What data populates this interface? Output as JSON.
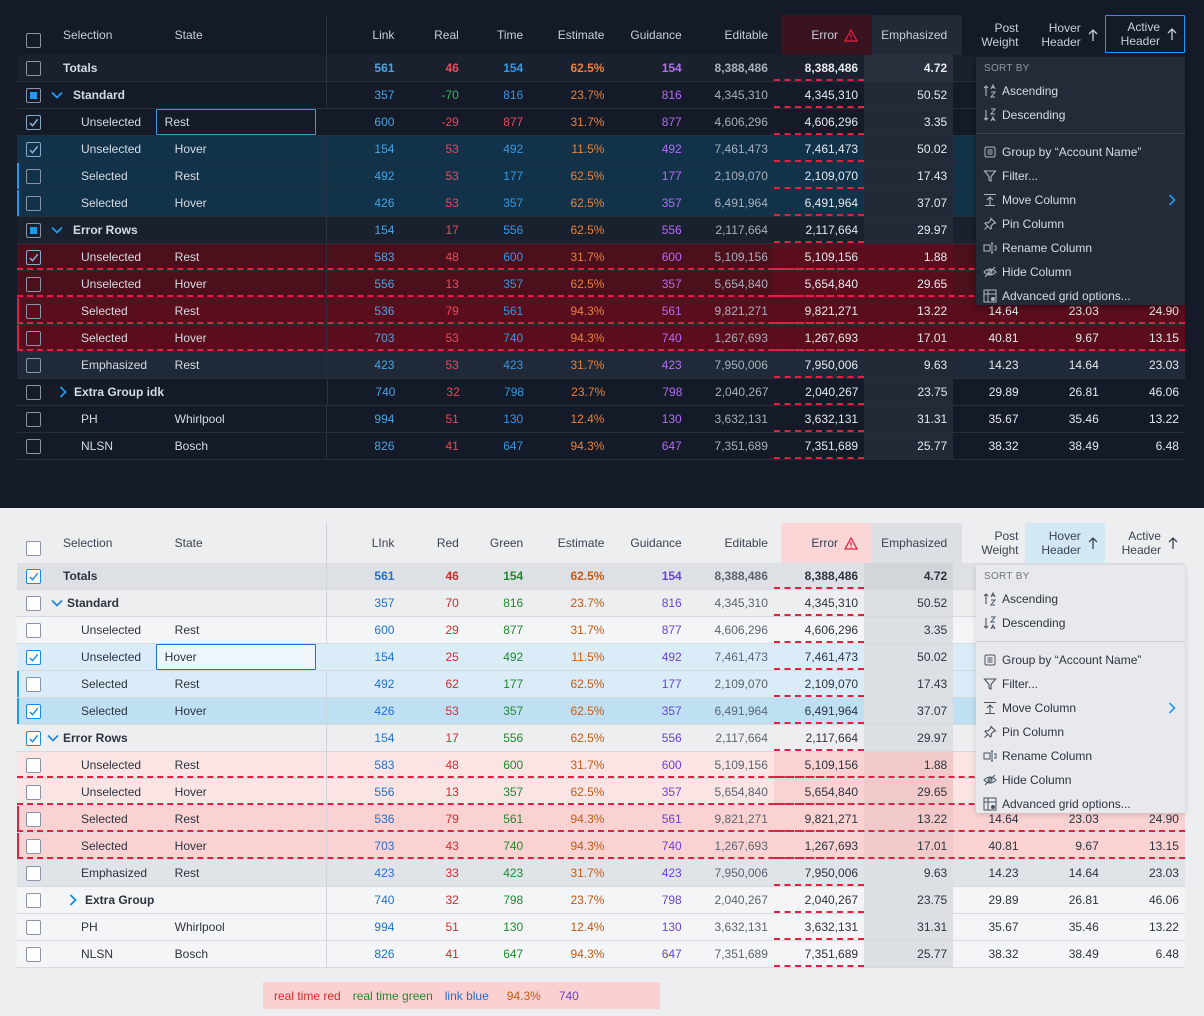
{
  "colors": {
    "dark": {
      "link": "#4ba3e3",
      "red": "#e94b5b",
      "green": "#3fb560",
      "blue": "#3399e6",
      "estimate": "#e8823c",
      "guidance": "#b36bf5",
      "muted": "#a8b0bd"
    },
    "light": {
      "link": "#1f6fd0",
      "red": "#d42b2b",
      "green": "#1f8a2e",
      "blue": "#1f6fd0",
      "estimate": "#c45a14",
      "guidance": "#6a42d6",
      "muted": "#5a6470"
    }
  },
  "dark": {
    "headers": {
      "selection": "Selection",
      "state": "State",
      "link": "Link",
      "real": "Real",
      "time": "Time",
      "estimate": "Estimate",
      "guidance": "Guidance",
      "editable": "Editable",
      "error": "Error",
      "emphasized": "Emphasized",
      "post_weight_1": "Post",
      "post_weight_2": "Weight",
      "hover_1": "Hover",
      "hover_2": "Header",
      "active_1": "Active",
      "active_2": "Header"
    },
    "rows": [
      {
        "type": "totals",
        "sel": "Totals",
        "state": "",
        "cb": "off",
        "link": "561",
        "real": "46",
        "time": "154",
        "est": "62.5%",
        "guid": "154",
        "edit": "8,388,486",
        "err": "8,388,486",
        "emph": "4.72",
        "pw": "",
        "hh": "",
        "ah": "",
        "bg": "#1a212e"
      },
      {
        "type": "group",
        "sel": "Standard",
        "state": "",
        "cb": "ind",
        "chev": "down",
        "link": "357",
        "real": "-70",
        "time": "816",
        "est": "23.7%",
        "guid": "816",
        "edit": "4,345,310",
        "err": "4,345,310",
        "emph": "50.52",
        "pw": "",
        "hh": "",
        "ah": "",
        "realColor": "green",
        "bg": "#141a27"
      },
      {
        "type": "child",
        "sel": "Unselected",
        "state": "Rest",
        "cb": "on",
        "link": "600",
        "real": "-29",
        "time": "877",
        "est": "31.7%",
        "guid": "877",
        "edit": "4,606,296",
        "err": "4,606,296",
        "emph": "3.35",
        "pw": "",
        "hh": "",
        "ah": "",
        "timeColor": "red",
        "bg": "#141a27",
        "stateBox": true
      },
      {
        "type": "child",
        "sel": "Unselected",
        "state": "Hover",
        "cb": "on",
        "link": "154",
        "real": "53",
        "time": "492",
        "est": "11.5%",
        "guid": "492",
        "edit": "7,461,473",
        "err": "7,461,473",
        "emph": "50.02",
        "pw": "",
        "hh": "",
        "ah": "",
        "bg": "#113249"
      },
      {
        "type": "child",
        "sel": "Selected",
        "state": "Rest",
        "cb": "off",
        "link": "492",
        "real": "53",
        "time": "177",
        "est": "62.5%",
        "guid": "177",
        "edit": "2,109,070",
        "err": "2,109,070",
        "emph": "17.43",
        "pw": "",
        "hh": "",
        "ah": "",
        "bg": "#113249",
        "leftBar": true
      },
      {
        "type": "child",
        "sel": "Selected",
        "state": "Hover",
        "cb": "off",
        "link": "426",
        "real": "53",
        "time": "357",
        "est": "62.5%",
        "guid": "357",
        "edit": "6,491,964",
        "err": "6,491,964",
        "emph": "37.07",
        "pw": "",
        "hh": "",
        "ah": "",
        "bg": "#113249",
        "leftBar": true
      },
      {
        "type": "group",
        "sel": "Error Rows",
        "state": "",
        "cb": "ind",
        "chev": "down",
        "link": "154",
        "real": "17",
        "time": "556",
        "est": "62.5%",
        "guid": "556",
        "edit": "2,117,664",
        "err": "2,117,664",
        "emph": "29.97",
        "pw": "",
        "hh": "",
        "ah": "",
        "bg": "#1a212e"
      },
      {
        "type": "child",
        "sel": "Unselected",
        "state": "Rest",
        "cb": "on",
        "link": "583",
        "real": "48",
        "time": "600",
        "est": "31.7%",
        "guid": "600",
        "edit": "5,109,156",
        "err": "5,109,156",
        "emph": "1.88",
        "pw": "",
        "hh": "",
        "ah": "",
        "bg": "#4c0f1c",
        "dash": true
      },
      {
        "type": "child",
        "sel": "Unselected",
        "state": "Hover",
        "cb": "off",
        "link": "556",
        "real": "13",
        "time": "357",
        "est": "62.5%",
        "guid": "357",
        "edit": "5,654,840",
        "err": "5,654,840",
        "emph": "29.65",
        "pw": "",
        "hh": "",
        "ah": "",
        "bg": "#4c0f1c",
        "dash": true
      },
      {
        "type": "child",
        "sel": "Selected",
        "state": "Rest",
        "cb": "off",
        "link": "536",
        "real": "79",
        "time": "561",
        "est": "94.3%",
        "guid": "561",
        "edit": "9,821,271",
        "err": "9,821,271",
        "emph": "13.22",
        "pw": "14.64",
        "hh": "23.03",
        "ah": "24.90",
        "bg": "#5a0d1c",
        "leftBar": true,
        "dash": true
      },
      {
        "type": "child",
        "sel": "Selected",
        "state": "Hover",
        "cb": "off",
        "link": "703",
        "real": "53",
        "time": "740",
        "est": "94.3%",
        "guid": "740",
        "edit": "1,267,693",
        "err": "1,267,693",
        "emph": "17.01",
        "pw": "40.81",
        "hh": "9.67",
        "ah": "13.15",
        "bg": "#5a0d1c",
        "leftBar": true,
        "dash": true
      },
      {
        "type": "child",
        "sel": "Emphasized",
        "state": "Rest",
        "cb": "off",
        "link": "423",
        "real": "53",
        "time": "423",
        "est": "31.7%",
        "guid": "423",
        "edit": "7,950,006",
        "err": "7,950,006",
        "emph": "9.63",
        "pw": "14.23",
        "hh": "14.64",
        "ah": "23.03",
        "bg": "#1f2937"
      },
      {
        "type": "group",
        "sel": "Extra Group idk",
        "state": "",
        "cb": "off",
        "chev": "right",
        "link": "740",
        "real": "32",
        "time": "798",
        "est": "23.7%",
        "guid": "798",
        "edit": "2,040,267",
        "err": "2,040,267",
        "emph": "23.75",
        "pw": "29.89",
        "hh": "26.81",
        "ah": "46.06",
        "bg": "#141a27"
      },
      {
        "type": "plain",
        "sel": "PH",
        "state": "Whirlpool",
        "cb": "off",
        "link": "994",
        "real": "51",
        "time": "130",
        "est": "12.4%",
        "guid": "130",
        "edit": "3,632,131",
        "err": "3,632,131",
        "emph": "31.31",
        "pw": "35.67",
        "hh": "35.46",
        "ah": "13.22",
        "bg": "#141a27"
      },
      {
        "type": "plain",
        "sel": "NLSN",
        "state": "Bosch",
        "cb": "off",
        "link": "826",
        "real": "41",
        "time": "647",
        "est": "94.3%",
        "guid": "647",
        "edit": "7,351,689",
        "err": "7,351,689",
        "emph": "25.77",
        "pw": "38.32",
        "hh": "38.49",
        "ah": "6.48",
        "bg": "#141a27"
      }
    ]
  },
  "light": {
    "headers": {
      "selection": "Selection",
      "state": "State",
      "link": "LInk",
      "real": "Red",
      "time": "Green",
      "estimate": "Estimate",
      "guidance": "Guidance",
      "editable": "Editable",
      "error": "Error",
      "emphasized": "Emphasized",
      "post_weight_1": "Post",
      "post_weight_2": "Weight",
      "hover_1": "Hover",
      "hover_2": "Header",
      "active_1": "Active",
      "active_2": "Header"
    },
    "rows": [
      {
        "type": "totals",
        "sel": "Totals",
        "state": "",
        "cb": "on",
        "link": "561",
        "real": "46",
        "time": "154",
        "est": "62.5%",
        "guid": "154",
        "edit": "8,388,486",
        "err": "8,388,486",
        "emph": "4.72",
        "pw": "",
        "hh": "",
        "ah": "",
        "timeColor": "green",
        "bg": "#dde0e4"
      },
      {
        "type": "group",
        "sel": "Standard",
        "state": "",
        "cb": "off",
        "chev": "down",
        "link": "357",
        "real": "70",
        "time": "816",
        "est": "23.7%",
        "guid": "816",
        "edit": "4,345,310",
        "err": "4,345,310",
        "emph": "50.52",
        "pw": "",
        "hh": "",
        "ah": "",
        "timeColor": "green",
        "bg": "#eceef0"
      },
      {
        "type": "child",
        "sel": "Unselected",
        "state": "Rest",
        "cb": "off",
        "link": "600",
        "real": "29",
        "time": "877",
        "est": "31.7%",
        "guid": "877",
        "edit": "4,606,296",
        "err": "4,606,296",
        "emph": "3.35",
        "pw": "",
        "hh": "",
        "ah": "",
        "timeColor": "green",
        "bg": "#f4f5f6"
      },
      {
        "type": "child",
        "sel": "Unselected",
        "state": "Hover",
        "cb": "on",
        "link": "154",
        "real": "25",
        "time": "492",
        "est": "11.5%",
        "guid": "492",
        "edit": "7,461,473",
        "err": "7,461,473",
        "emph": "50.02",
        "pw": "",
        "hh": "",
        "ah": "",
        "timeColor": "green",
        "bg": "#d9ecf7",
        "stateBox": true
      },
      {
        "type": "child",
        "sel": "Selected",
        "state": "Rest",
        "cb": "off",
        "link": "492",
        "real": "62",
        "time": "177",
        "est": "62.5%",
        "guid": "177",
        "edit": "2,109,070",
        "err": "2,109,070",
        "emph": "17.43",
        "pw": "",
        "hh": "",
        "ah": "",
        "timeColor": "green",
        "bg": "#d9ecf7",
        "leftBar": true
      },
      {
        "type": "child",
        "sel": "Selected",
        "state": "Hover",
        "cb": "on",
        "link": "426",
        "real": "53",
        "time": "357",
        "est": "62.5%",
        "guid": "357",
        "edit": "6,491,964",
        "err": "6,491,964",
        "emph": "37.07",
        "pw": "",
        "hh": "",
        "ah": "",
        "timeColor": "green",
        "bg": "#bfe0f2",
        "leftBar": true
      },
      {
        "type": "group",
        "sel": "Error Rows",
        "state": "",
        "cb": "on",
        "chev": "down",
        "link": "154",
        "real": "17",
        "time": "556",
        "est": "62.5%",
        "guid": "556",
        "edit": "2,117,664",
        "err": "2,117,664",
        "emph": "29.97",
        "pw": "",
        "hh": "",
        "ah": "",
        "timeColor": "green",
        "bg": "#eceef0"
      },
      {
        "type": "child",
        "sel": "Unselected",
        "state": "Rest",
        "cb": "off",
        "link": "583",
        "real": "48",
        "time": "600",
        "est": "31.7%",
        "guid": "600",
        "edit": "5,109,156",
        "err": "5,109,156",
        "emph": "1.88",
        "pw": "",
        "hh": "",
        "ah": "",
        "timeColor": "green",
        "bg": "#fbe4e4",
        "dash": true
      },
      {
        "type": "child",
        "sel": "Unselected",
        "state": "Hover",
        "cb": "off",
        "link": "556",
        "real": "13",
        "time": "357",
        "est": "62.5%",
        "guid": "357",
        "edit": "5,654,840",
        "err": "5,654,840",
        "emph": "29.65",
        "pw": "",
        "hh": "",
        "ah": "",
        "timeColor": "green",
        "bg": "#fbe4e4",
        "dash": true
      },
      {
        "type": "child",
        "sel": "Selected",
        "state": "Rest",
        "cb": "off",
        "link": "536",
        "real": "79",
        "time": "561",
        "est": "94.3%",
        "guid": "561",
        "edit": "9,821,271",
        "err": "9,821,271",
        "emph": "13.22",
        "pw": "14.64",
        "hh": "23.03",
        "ah": "24.90",
        "timeColor": "green",
        "bg": "#fad2d2",
        "leftBar": true,
        "dash": true
      },
      {
        "type": "child",
        "sel": "Selected",
        "state": "Hover",
        "cb": "off",
        "link": "703",
        "real": "43",
        "time": "740",
        "est": "94.3%",
        "guid": "740",
        "edit": "1,267,693",
        "err": "1,267,693",
        "emph": "17.01",
        "pw": "40.81",
        "hh": "9.67",
        "ah": "13.15",
        "timeColor": "green",
        "bg": "#fad2d2",
        "leftBar": true,
        "dash": true
      },
      {
        "type": "child",
        "sel": "Emphasized",
        "state": "Rest",
        "cb": "off",
        "link": "423",
        "real": "33",
        "time": "423",
        "est": "31.7%",
        "guid": "423",
        "edit": "7,950,006",
        "err": "7,950,006",
        "emph": "9.63",
        "pw": "14.23",
        "hh": "14.64",
        "ah": "23.03",
        "timeColor": "green",
        "bg": "#e0e3e7"
      },
      {
        "type": "group",
        "sel": "Extra Group",
        "state": "",
        "cb": "off",
        "chev": "right",
        "link": "740",
        "real": "32",
        "time": "798",
        "est": "23.7%",
        "guid": "798",
        "edit": "2,040,267",
        "err": "2,040,267",
        "emph": "23.75",
        "pw": "29.89",
        "hh": "26.81",
        "ah": "46.06",
        "timeColor": "green",
        "bg": "#f4f5f6"
      },
      {
        "type": "plain",
        "sel": "PH",
        "state": "Whirlpool",
        "cb": "off",
        "link": "994",
        "real": "51",
        "time": "130",
        "est": "12.4%",
        "guid": "130",
        "edit": "3,632,131",
        "err": "3,632,131",
        "emph": "31.31",
        "pw": "35.67",
        "hh": "35.46",
        "ah": "13.22",
        "timeColor": "green",
        "bg": "#f4f5f6"
      },
      {
        "type": "plain",
        "sel": "NLSN",
        "state": "Bosch",
        "cb": "off",
        "link": "826",
        "real": "41",
        "time": "647",
        "est": "94.3%",
        "guid": "647",
        "edit": "7,351,689",
        "err": "7,351,689",
        "emph": "25.77",
        "pw": "38.32",
        "hh": "38.49",
        "ah": "6.48",
        "timeColor": "green",
        "bg": "#f4f5f6"
      }
    ]
  },
  "menu": {
    "sort_by": "SORT BY",
    "ascending": "Ascending",
    "descending": "Descending",
    "group_by": "Group by “Account Name”",
    "filter": "Filter...",
    "move_column": "Move Column",
    "pin_column": "Pin Column",
    "rename_column": "Rename Column",
    "hide_column": "Hide Column",
    "advanced": "Advanced grid options..."
  },
  "legend": {
    "red": "real time red",
    "green": "real time green",
    "blue": "link blue",
    "pct": "94.3%",
    "num": "740"
  }
}
